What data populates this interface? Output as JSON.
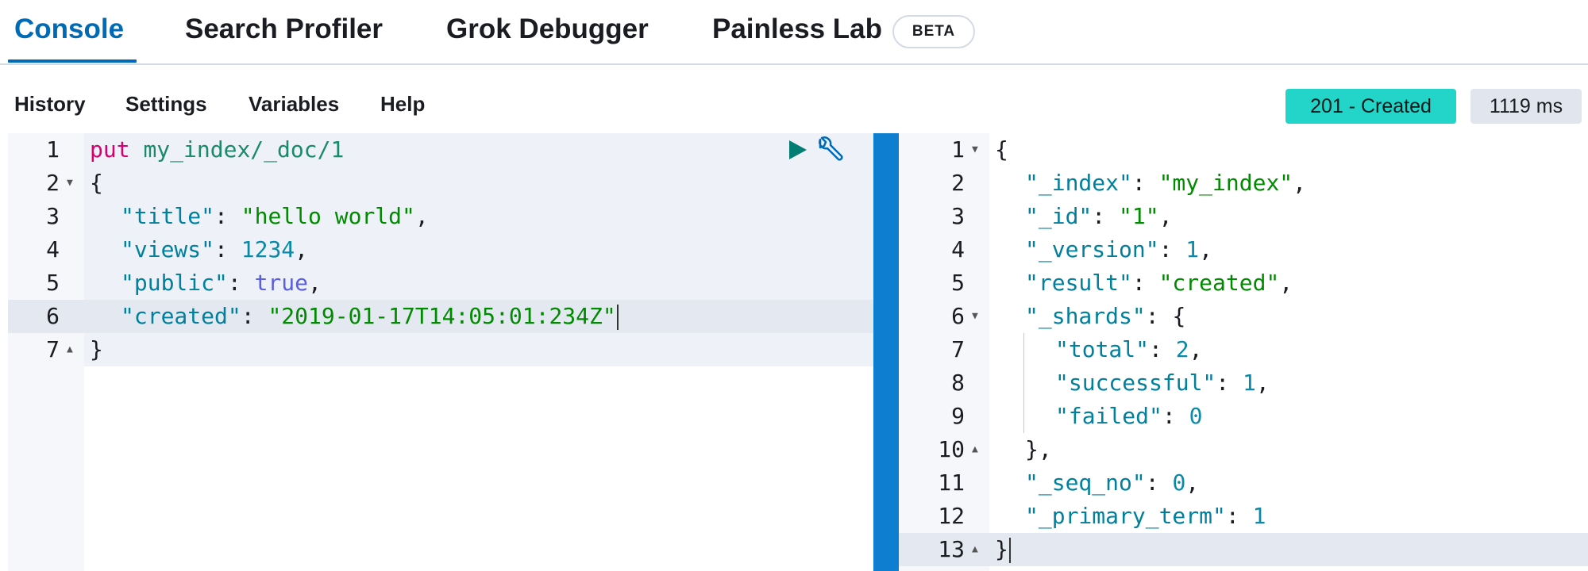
{
  "tabs": [
    {
      "label": "Console"
    },
    {
      "label": "Search Profiler"
    },
    {
      "label": "Grok Debugger"
    },
    {
      "label": "Painless Lab"
    }
  ],
  "beta_label": "BETA",
  "menu": [
    "History",
    "Settings",
    "Variables",
    "Help"
  ],
  "status": {
    "code": "201 - Created",
    "time": "1119 ms",
    "badge_color": "#23d5c9"
  },
  "request": {
    "line_numbers": [
      "1",
      "2",
      "3",
      "4",
      "5",
      "6",
      "7"
    ],
    "method": "put",
    "path": "my_index/_doc/1",
    "lines": [
      {
        "k": "\"title\"",
        "v": "\"hello world\"",
        "vtype": "s",
        "comma": ","
      },
      {
        "k": "\"views\"",
        "v": "1234",
        "vtype": "n",
        "comma": ","
      },
      {
        "k": "\"public\"",
        "v": "true",
        "vtype": "b",
        "comma": ","
      },
      {
        "k": "\"created\"",
        "v": "\"2019-01-17T14:05:01:234Z\"",
        "vtype": "s",
        "comma": ""
      }
    ],
    "open_brace": "{",
    "close_brace": "}"
  },
  "response": {
    "line_numbers": [
      "1",
      "2",
      "3",
      "4",
      "5",
      "6",
      "7",
      "8",
      "9",
      "10",
      "11",
      "12",
      "13"
    ],
    "lines": [
      {
        "k": "\"_index\"",
        "v": "\"my_index\"",
        "vtype": "s",
        "comma": ","
      },
      {
        "k": "\"_id\"",
        "v": "\"1\"",
        "vtype": "s",
        "comma": ","
      },
      {
        "k": "\"_version\"",
        "v": "1",
        "vtype": "n",
        "comma": ","
      },
      {
        "k": "\"result\"",
        "v": "\"created\"",
        "vtype": "s",
        "comma": ","
      },
      {
        "k": "\"_shards\"",
        "v": "{",
        "vtype": "p",
        "comma": ""
      },
      {
        "k": "\"total\"",
        "v": "2",
        "vtype": "n",
        "comma": ","
      },
      {
        "k": "\"successful\"",
        "v": "1",
        "vtype": "n",
        "comma": ","
      },
      {
        "k": "\"failed\"",
        "v": "0",
        "vtype": "n",
        "comma": ""
      },
      {
        "k": "",
        "v": "},",
        "vtype": "p",
        "comma": ""
      },
      {
        "k": "\"_seq_no\"",
        "v": "0",
        "vtype": "n",
        "comma": ","
      },
      {
        "k": "\"_primary_term\"",
        "v": "1",
        "vtype": "n",
        "comma": ""
      }
    ],
    "open_brace": "{",
    "close_brace": "}"
  },
  "icons": {
    "run": "play-icon",
    "settings": "wrench-icon"
  }
}
